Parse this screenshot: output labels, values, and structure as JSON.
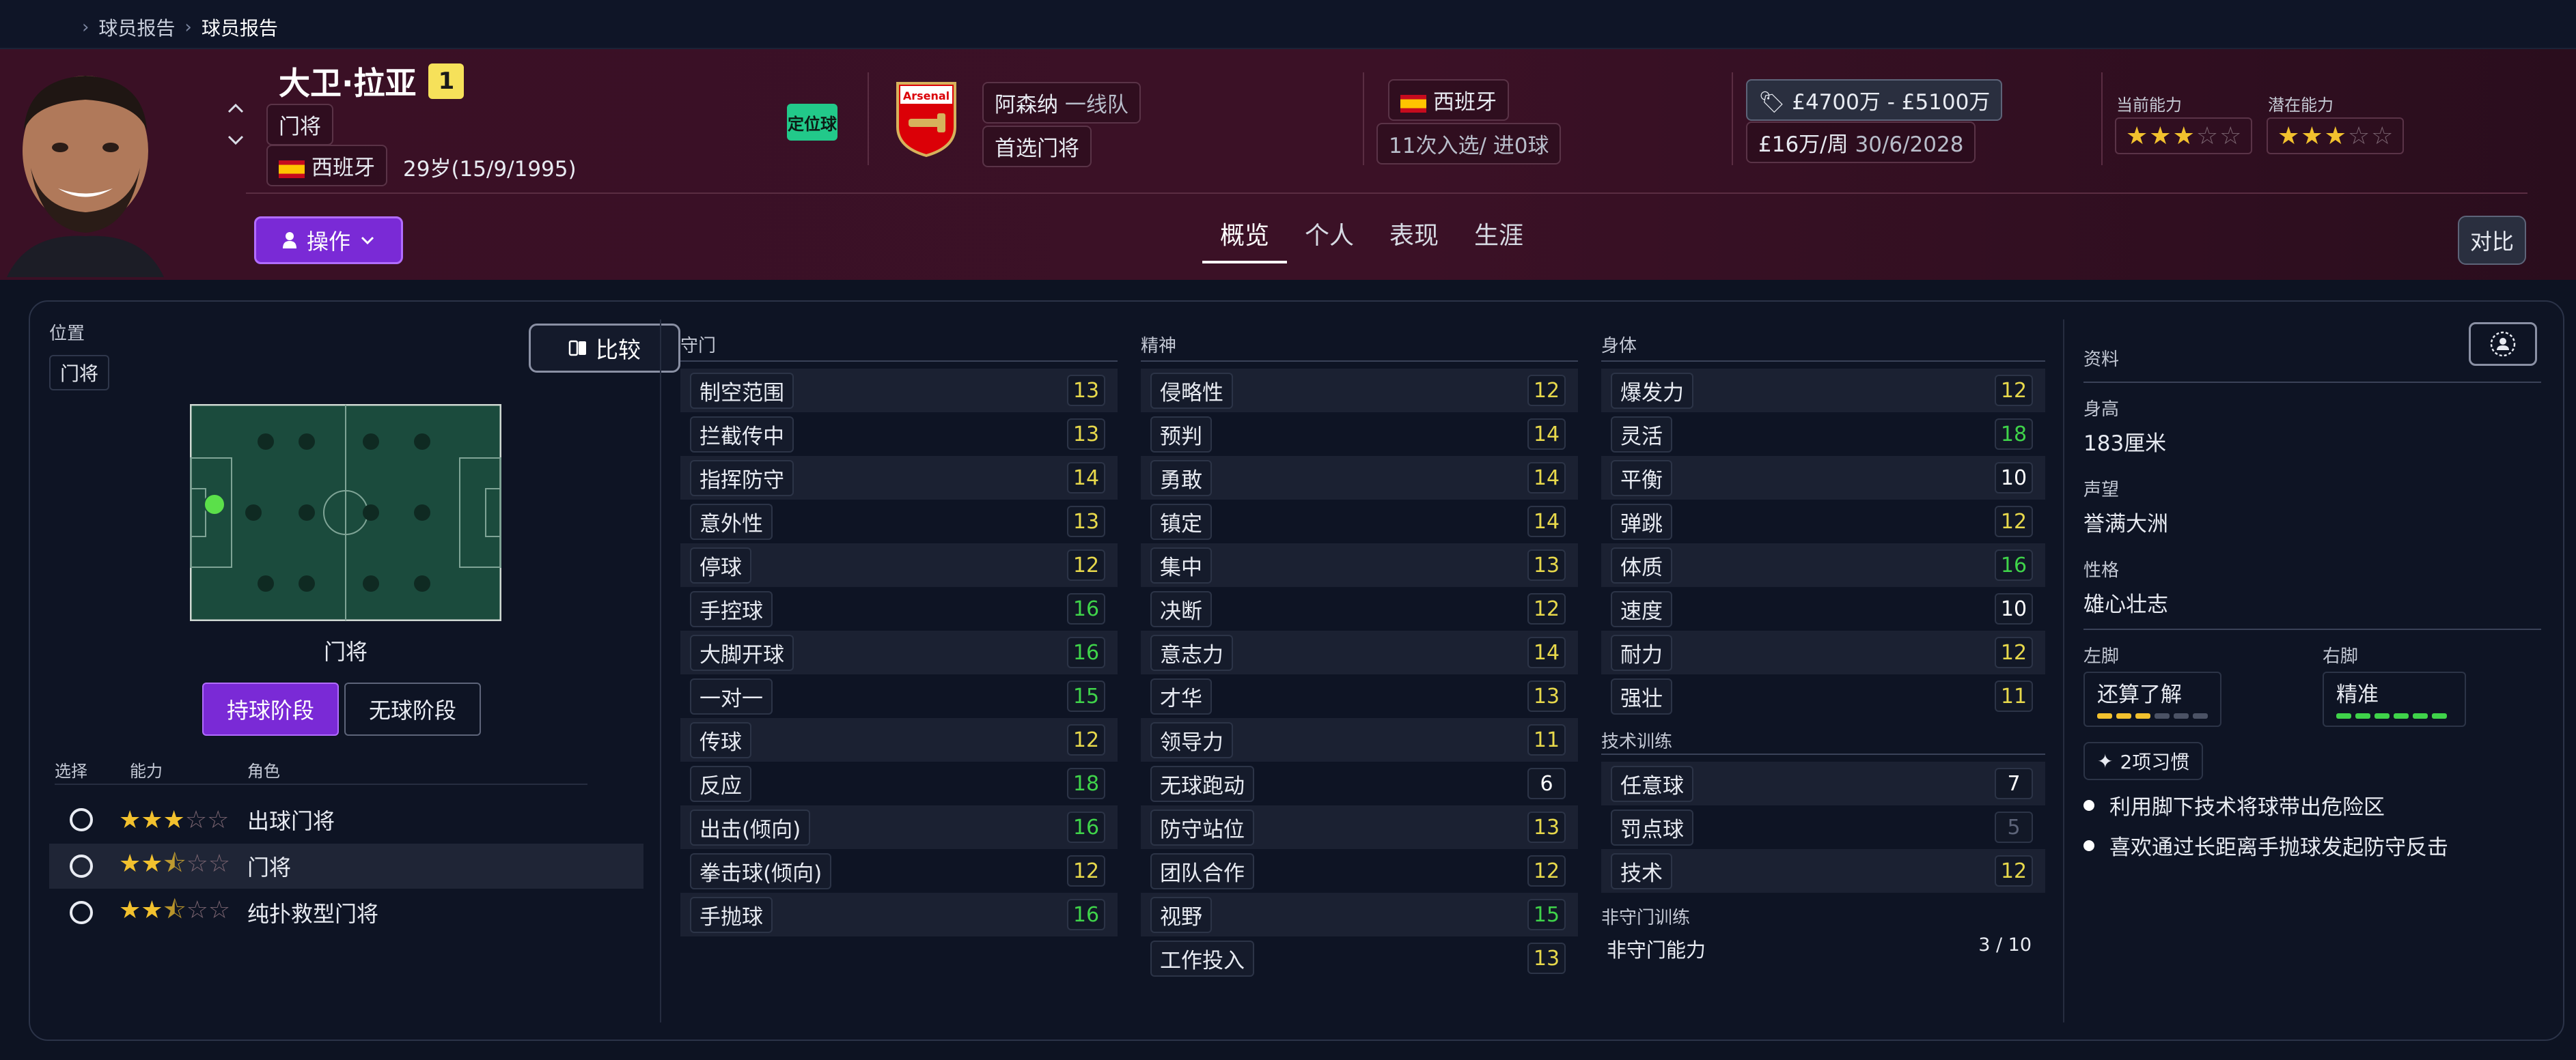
{
  "breadcrumb": {
    "items": [
      "球员报告",
      "球员报告"
    ]
  },
  "player": {
    "name": "大卫·拉亚",
    "number": "1",
    "position": "门将",
    "nationality": "西班牙",
    "age": "29岁(15/9/1995)",
    "setpiece_tag": "定位球"
  },
  "club": {
    "name": "阿森纳",
    "team": "一线队",
    "role": "首选门将",
    "logo_text": "Arsenal"
  },
  "national": {
    "country": "西班牙",
    "caps": "11次入选/ 进0球"
  },
  "contract": {
    "value": "£4700万 - £5100万",
    "wage": "£16万/周",
    "expiry": "30/6/2028"
  },
  "ability": {
    "current_label": "当前能力",
    "current_stars": 3,
    "potential_label": "潜在能力",
    "potential_stars": 3
  },
  "actions": {
    "action_label": "操作",
    "compare_label": "对比"
  },
  "tabs": [
    "概览",
    "个人",
    "表现",
    "生涯"
  ],
  "position_panel": {
    "label": "位置",
    "chip": "门将",
    "compare_label": "比较",
    "pitch_caption": "门将",
    "phase_in": "持球阶段",
    "phase_out": "无球阶段",
    "role_headers": [
      "选择",
      "能力",
      "角色"
    ],
    "roles": [
      {
        "name": "出球门将",
        "stars": 3
      },
      {
        "name": "门将",
        "stars": 2.5
      },
      {
        "name": "纯扑救型门将",
        "stars": 2.5
      }
    ]
  },
  "goalkeeping": {
    "title": "守门",
    "attributes": [
      {
        "name": "制空范围",
        "value": 13
      },
      {
        "name": "拦截传中",
        "value": 13
      },
      {
        "name": "指挥防守",
        "value": 14
      },
      {
        "name": "意外性",
        "value": 13
      },
      {
        "name": "停球",
        "value": 12
      },
      {
        "name": "手控球",
        "value": 16
      },
      {
        "name": "大脚开球",
        "value": 16
      },
      {
        "name": "一对一",
        "value": 15
      },
      {
        "name": "传球",
        "value": 12
      },
      {
        "name": "反应",
        "value": 18
      },
      {
        "name": "出击(倾向)",
        "value": 16
      },
      {
        "name": "拳击球(倾向)",
        "value": 12
      },
      {
        "name": "手抛球",
        "value": 16
      }
    ]
  },
  "mental": {
    "title": "精神",
    "attributes": [
      {
        "name": "侵略性",
        "value": 12
      },
      {
        "name": "预判",
        "value": 14
      },
      {
        "name": "勇敢",
        "value": 14
      },
      {
        "name": "镇定",
        "value": 14
      },
      {
        "name": "集中",
        "value": 13
      },
      {
        "name": "决断",
        "value": 12
      },
      {
        "name": "意志力",
        "value": 14
      },
      {
        "name": "才华",
        "value": 13
      },
      {
        "name": "领导力",
        "value": 11
      },
      {
        "name": "无球跑动",
        "value": 6
      },
      {
        "name": "防守站位",
        "value": 13
      },
      {
        "name": "团队合作",
        "value": 12
      },
      {
        "name": "视野",
        "value": 15
      },
      {
        "name": "工作投入",
        "value": 13
      }
    ]
  },
  "physical": {
    "title": "身体",
    "attributes": [
      {
        "name": "爆发力",
        "value": 12
      },
      {
        "name": "灵活",
        "value": 18
      },
      {
        "name": "平衡",
        "value": 10
      },
      {
        "name": "弹跳",
        "value": 12
      },
      {
        "name": "体质",
        "value": 16
      },
      {
        "name": "速度",
        "value": 10
      },
      {
        "name": "耐力",
        "value": 12
      },
      {
        "name": "强壮",
        "value": 11
      }
    ],
    "tech_title": "技术训练",
    "tech": [
      {
        "name": "任意球",
        "value": 7
      },
      {
        "name": "罚点球",
        "value": 5
      },
      {
        "name": "技术",
        "value": 12
      }
    ],
    "non_gk_title": "非守门训练",
    "non_gk_label": "非守门能力",
    "non_gk_value": "3 / 10"
  },
  "info": {
    "title": "资料",
    "height_label": "身高",
    "height": "183厘米",
    "reputation_label": "声望",
    "reputation": "誉满大洲",
    "personality_label": "性格",
    "personality": "雄心壮志",
    "left_foot_label": "左脚",
    "left_foot": "还算了解",
    "left_foot_level": 3,
    "right_foot_label": "右脚",
    "right_foot": "精准",
    "right_foot_level": 6,
    "habits_label": "2项习惯",
    "habits": [
      "利用脚下技术将球带出危险区",
      "喜欢通过长距离手抛球发起防守反击"
    ]
  },
  "colors": {
    "accent": "#7a2ad6",
    "value_yellow": "#e7d84b",
    "value_green": "#3fd34a",
    "header_bg": "#3a1025"
  }
}
